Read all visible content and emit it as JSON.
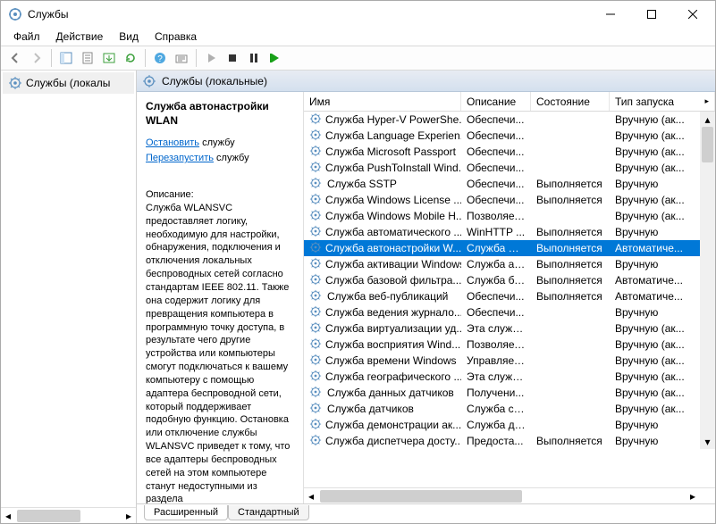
{
  "window": {
    "title": "Службы"
  },
  "menu": {
    "file": "Файл",
    "action": "Действие",
    "view": "Вид",
    "help": "Справка"
  },
  "left": {
    "node": "Службы (локалы"
  },
  "pane_header": "Службы (локальные)",
  "detail": {
    "title": "Служба автонастройки WLAN",
    "stop_pre": "Остановить",
    "stop_post": " службу",
    "restart_pre": "Перезапустить",
    "restart_post": " службу",
    "desc_label": "Описание:",
    "desc": "Служба WLANSVC предоставляет логику, необходимую для настройки, обнаружения, подключения и отключения локальных беспроводных сетей согласно стандартам IEEE 802.11. Также она содержит логику для превращения компьютера в программную точку доступа, в результате чего другие устройства или компьютеры смогут подключаться к вашему компьютеру с помощью адаптера беспроводной сети, который поддерживает подобную функцию. Остановка или отключение службы WLANSVC приведет к тому, что все адаптеры беспроводных сетей на этом компьютере станут недоступными из раздела"
  },
  "columns": {
    "name": "Имя",
    "desc": "Описание",
    "state": "Состояние",
    "start": "Тип запуска"
  },
  "tabs": {
    "ext": "Расширенный",
    "std": "Стандартный"
  },
  "services": [
    {
      "name": "Служба Hyper-V PowerShe...",
      "desc": "Обеспечи...",
      "state": "",
      "start": "Вручную (ак...",
      "sel": false
    },
    {
      "name": "Служба Language Experien...",
      "desc": "Обеспечи...",
      "state": "",
      "start": "Вручную (ак...",
      "sel": false
    },
    {
      "name": "Служба Microsoft Passport",
      "desc": "Обеспечи...",
      "state": "",
      "start": "Вручную (ак...",
      "sel": false
    },
    {
      "name": "Служба PushToInstall Wind...",
      "desc": "Обеспечи...",
      "state": "",
      "start": "Вручную (ак...",
      "sel": false
    },
    {
      "name": "Служба SSTP",
      "desc": "Обеспечи...",
      "state": "Выполняется",
      "start": "Вручную",
      "sel": false
    },
    {
      "name": "Служба Windows License ...",
      "desc": "Обеспечи...",
      "state": "Выполняется",
      "start": "Вручную (ак...",
      "sel": false
    },
    {
      "name": "Служба Windows Mobile H...",
      "desc": "Позволяет...",
      "state": "",
      "start": "Вручную (ак...",
      "sel": false
    },
    {
      "name": "Служба автоматического ...",
      "desc": "WinHTTP ...",
      "state": "Выполняется",
      "start": "Вручную",
      "sel": false
    },
    {
      "name": "Служба автонастройки W...",
      "desc": "Служба W...",
      "state": "Выполняется",
      "start": "Автоматиче...",
      "sel": true
    },
    {
      "name": "Служба активации Windows",
      "desc": "Служба ак...",
      "state": "Выполняется",
      "start": "Вручную",
      "sel": false
    },
    {
      "name": "Служба базовой фильтра...",
      "desc": "Служба ба...",
      "state": "Выполняется",
      "start": "Автоматиче...",
      "sel": false
    },
    {
      "name": "Служба веб-публикаций",
      "desc": "Обеспечи...",
      "state": "Выполняется",
      "start": "Автоматиче...",
      "sel": false
    },
    {
      "name": "Служба ведения журнало...",
      "desc": "Обеспечи...",
      "state": "",
      "start": "Вручную",
      "sel": false
    },
    {
      "name": "Служба виртуализации уд...",
      "desc": "Эта служб...",
      "state": "",
      "start": "Вручную (ак...",
      "sel": false
    },
    {
      "name": "Служба восприятия Wind...",
      "desc": "Позволяет...",
      "state": "",
      "start": "Вручную (ак...",
      "sel": false
    },
    {
      "name": "Служба времени Windows",
      "desc": "Управляет...",
      "state": "",
      "start": "Вручную (ак...",
      "sel": false
    },
    {
      "name": "Служба географического ...",
      "desc": "Эта служб...",
      "state": "",
      "start": "Вручную (ак...",
      "sel": false
    },
    {
      "name": "Служба данных датчиков",
      "desc": "Получени...",
      "state": "",
      "start": "Вручную (ак...",
      "sel": false
    },
    {
      "name": "Служба датчиков",
      "desc": "Служба се...",
      "state": "",
      "start": "Вручную (ак...",
      "sel": false
    },
    {
      "name": "Служба демонстрации ак...",
      "desc": "Служба де...",
      "state": "",
      "start": "Вручную",
      "sel": false
    },
    {
      "name": "Служба диспетчера досту...",
      "desc": "Предоста...",
      "state": "Выполняется",
      "start": "Вручную",
      "sel": false
    }
  ]
}
